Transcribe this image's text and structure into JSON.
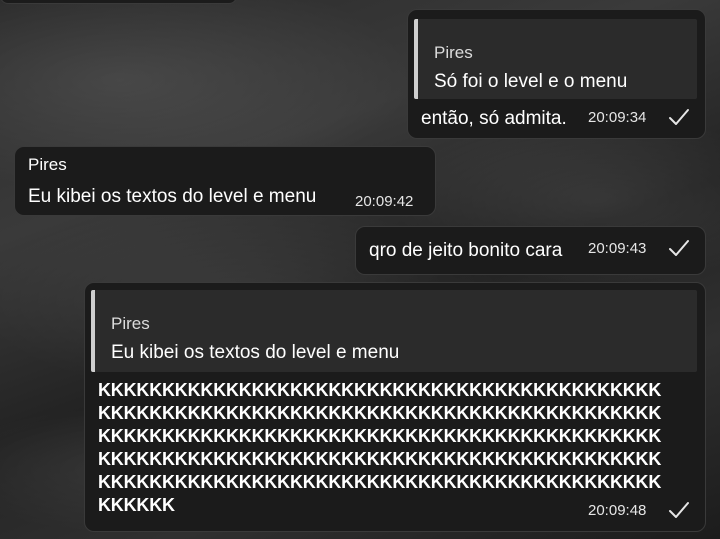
{
  "messages": [
    {
      "id": "m1",
      "reply": {
        "name": "Pires",
        "text": "Só foi o level e o menu"
      },
      "text": "então, só admita.",
      "time": "20:09:34",
      "outgoing": true
    },
    {
      "id": "m2",
      "sender": "Pires",
      "text": "Eu kibei os textos do level e menu",
      "time": "20:09:42",
      "outgoing": false
    },
    {
      "id": "m3",
      "text": "qro de jeito bonito cara",
      "time": "20:09:43",
      "outgoing": true
    },
    {
      "id": "m4",
      "reply": {
        "name": "Pires",
        "text": "Eu kibei os textos do level e menu"
      },
      "lines": [
        "KKKKKKKKKKKKKKKKKKKKKKKKKKKKKKKKKKKKKKKKKKKK",
        "KKKKKKKKKKKKKKKKKKKKKKKKKKKKKKKKKKKKKKKKKKKK",
        "KKKKKKKKKKKKKKKKKKKKKKKKKKKKKKKKKKKKKKKKKKKK",
        "KKKKKKKKKKKKKKKKKKKKKKKKKKKKKKKKKKKKKKKKKKKK",
        "KKKKKKKKKKKKKKKKKKKKKKKKKKKKKKKKKKKKKKKKKKKK",
        "KKKKKK"
      ],
      "time": "20:09:48",
      "outgoing": true
    }
  ],
  "colors": {
    "bubble": "#1b1b1b",
    "quote_bg": "#2b2b2b",
    "quote_bar": "#cfcfcf",
    "text": "#ffffff"
  },
  "icons": {
    "read_receipt": "check-icon"
  }
}
